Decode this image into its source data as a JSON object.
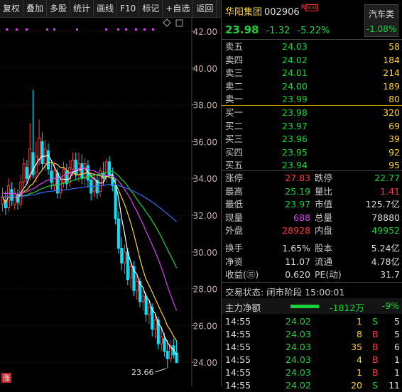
{
  "toolbar": [
    "复权",
    "叠加",
    "多股",
    "统计",
    "画线",
    "F10",
    "标记",
    "+自选",
    "返回"
  ],
  "chart": {
    "y_labels": [
      "42.00",
      "40.00",
      "38.00",
      "36.00",
      "34.00",
      "32.00",
      "30.00",
      "28.00",
      "26.00",
      "24.00"
    ],
    "low_label": "23.66",
    "zhang_label": "涨",
    "colors": {
      "up": "#ff3b3b",
      "down": "#00e5ff",
      "ma5": "#ffffff",
      "ma10": "#ffd23a",
      "ma20": "#d946ef",
      "ma30": "#19d23a",
      "ma60": "#3b6cff"
    }
  },
  "header": {
    "name": "华阳集团",
    "code": "002906",
    "tag": "R",
    "price": "23.98",
    "change": "-1.32",
    "pct": "-5.22%",
    "sector_name": "汽车类",
    "sector_pct": "-1.08%"
  },
  "asks": [
    {
      "label": "卖五",
      "price": "24.03",
      "vol": "58"
    },
    {
      "label": "卖四",
      "price": "24.02",
      "vol": "184"
    },
    {
      "label": "卖三",
      "price": "24.01",
      "vol": "214"
    },
    {
      "label": "卖二",
      "price": "24.00",
      "vol": "189"
    },
    {
      "label": "卖一",
      "price": "23.99",
      "vol": "80"
    }
  ],
  "bids": [
    {
      "label": "买一",
      "price": "23.98",
      "vol": "320"
    },
    {
      "label": "买二",
      "price": "23.97",
      "vol": "69"
    },
    {
      "label": "买三",
      "price": "23.96",
      "vol": "39"
    },
    {
      "label": "买四",
      "price": "23.95",
      "vol": "92"
    },
    {
      "label": "买五",
      "price": "23.94",
      "vol": "95"
    }
  ],
  "stats": [
    {
      "l1": "涨停",
      "v1": "27.83",
      "c1": "r",
      "l2": "跌停",
      "v2": "22.77",
      "c2": "g"
    },
    {
      "l1": "最高",
      "v1": "25.19",
      "c1": "g",
      "l2": "量比",
      "v2": "1.41",
      "c2": "r"
    },
    {
      "l1": "最低",
      "v1": "23.97",
      "c1": "g",
      "l2": "市值",
      "v2": "125.7亿",
      "c2": "w"
    },
    {
      "l1": "现量",
      "v1": "688",
      "c1": "m",
      "l2": "总量",
      "v2": "78880",
      "c2": "w"
    },
    {
      "l1": "外盘",
      "v1": "28928",
      "c1": "r",
      "l2": "内盘",
      "v2": "49952",
      "c2": "g"
    },
    {
      "l1": "换手",
      "v1": "1.65%",
      "c1": "w",
      "l2": "股本",
      "v2": "5.24亿",
      "c2": "w"
    },
    {
      "l1": "净资",
      "v1": "11.07",
      "c1": "w",
      "l2": "流通",
      "v2": "4.78亿",
      "c2": "w"
    },
    {
      "l1": "收益(㊂)",
      "v1": "0.620",
      "c1": "w",
      "l2": "PE(动)",
      "v2": "31.7",
      "c2": "w"
    }
  ],
  "status": "交易状态: 闭市阶段 15:00:01",
  "flow": {
    "label": "主力净额",
    "value": "-1812万",
    "pct": "-9%"
  },
  "ticks": [
    {
      "t": "14:55",
      "p": "24.02",
      "q": "1",
      "s": "S",
      "c": "5",
      "sc": "g"
    },
    {
      "t": "14:55",
      "p": "24.03",
      "q": "8",
      "s": "B",
      "c": "5",
      "sc": "r"
    },
    {
      "t": "14:55",
      "p": "24.03",
      "q": "35",
      "s": "B",
      "c": "6",
      "sc": "r"
    },
    {
      "t": "14:55",
      "p": "24.03",
      "q": "4",
      "s": "B",
      "c": "1",
      "sc": "r"
    },
    {
      "t": "14:55",
      "p": "24.03",
      "q": "1",
      "s": "B",
      "c": "1",
      "sc": "r"
    },
    {
      "t": "14:55",
      "p": "24.02",
      "q": "20",
      "s": "S",
      "c": "11",
      "sc": "g"
    }
  ]
}
